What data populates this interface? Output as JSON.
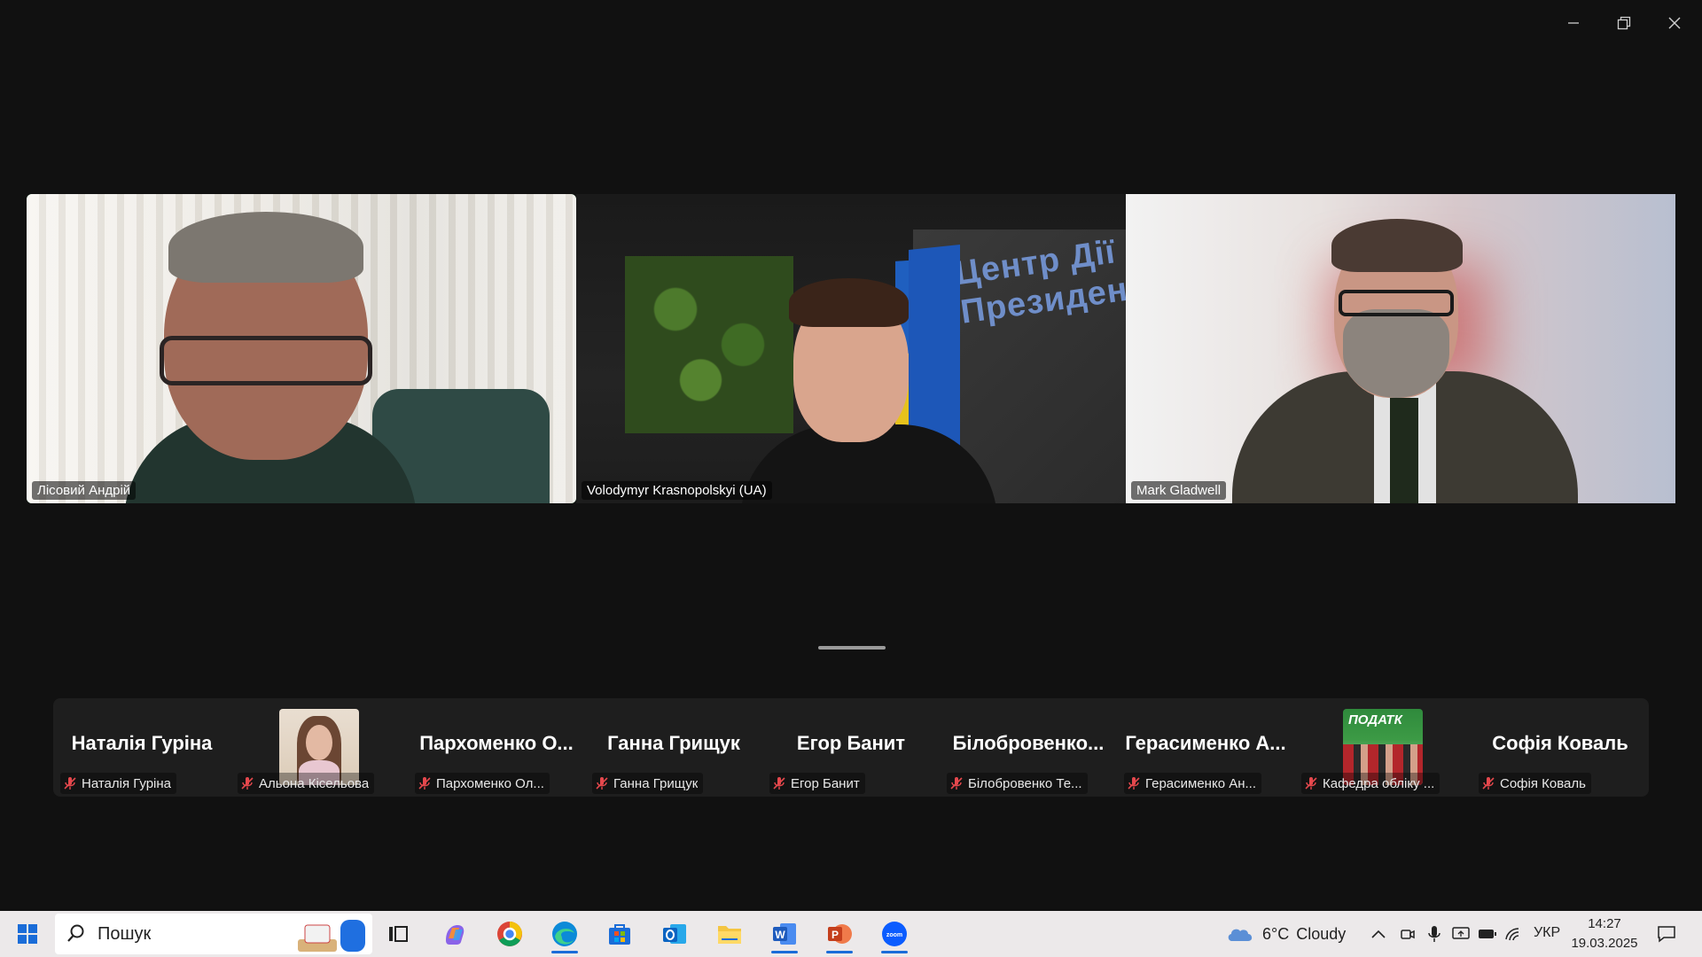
{
  "window": {
    "controls": {
      "minimize_icon": "minimize-icon",
      "restore_icon": "restore-icon",
      "close_icon": "close-icon"
    }
  },
  "video_tiles": [
    {
      "name": "Лісовий Андрій",
      "active_speaker": true
    },
    {
      "name": "Volodymyr Krasnopolskyi (UA)",
      "active_speaker": false,
      "background_sign": "Центр Дії Президен"
    },
    {
      "name": "Mark Gladwell",
      "active_speaker": false
    }
  ],
  "participants": [
    {
      "display": "Наталія Гуріна",
      "label": "Наталія Гуріна",
      "muted": true,
      "has_video": false
    },
    {
      "display": "",
      "label": "Альона Кісельова",
      "muted": true,
      "has_video": true,
      "avatar": "photo-woman"
    },
    {
      "display": "Пархоменко О...",
      "label": "Пархоменко Ол...",
      "muted": true,
      "has_video": false
    },
    {
      "display": "Ганна Грищук",
      "label": "Ганна Грищук",
      "muted": true,
      "has_video": false
    },
    {
      "display": "Егор Банит",
      "label": "Егор Банит",
      "muted": true,
      "has_video": false
    },
    {
      "display": "Білобровенко...",
      "label": "Білобровенко Те...",
      "muted": true,
      "has_video": false
    },
    {
      "display": "Герасименко А...",
      "label": "Герасименко Ан...",
      "muted": true,
      "has_video": false
    },
    {
      "display": "",
      "label": "Кафедра обліку ...",
      "muted": true,
      "has_video": true,
      "avatar": "group-photo",
      "avatar_text": "ПОДАТК"
    },
    {
      "display": "Софія Коваль",
      "label": "Софія Коваль",
      "muted": true,
      "has_video": false
    }
  ],
  "taskbar": {
    "search_placeholder": "Пошук",
    "apps": [
      "windows-start-icon",
      "task-view-icon",
      "copilot-icon",
      "chrome-icon",
      "edge-icon",
      "store-icon",
      "outlook-icon",
      "file-explorer-icon",
      "word-icon",
      "powerpoint-icon",
      "zoom-icon"
    ],
    "weather": {
      "temp": "6°C",
      "condition": "Cloudy"
    },
    "language": "УКР",
    "time": "14:27",
    "date": "19.03.2025"
  },
  "colors": {
    "active_speaker_border": "#22c55e",
    "background": "#111111",
    "strip": "#1e1e1e",
    "muted_mic": "#e5484d",
    "taskbar": "#ece9ea",
    "zoom_blue": "#0b5cff"
  }
}
